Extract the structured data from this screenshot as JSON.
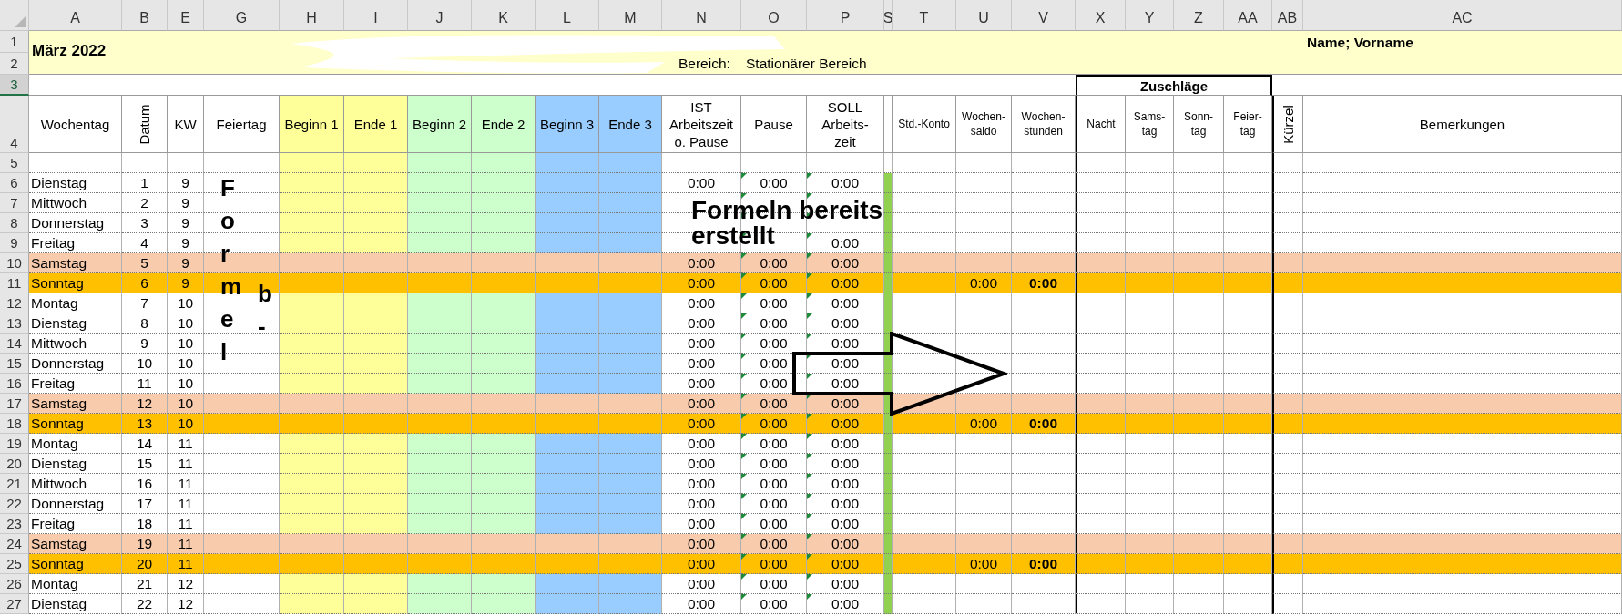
{
  "columns": [
    "A",
    "B",
    "E",
    "G",
    "H",
    "I",
    "J",
    "K",
    "L",
    "M",
    "N",
    "O",
    "P",
    "S",
    "T",
    "U",
    "V",
    "X",
    "Y",
    "Z",
    "AA",
    "AB",
    "AC"
  ],
  "title_band": {
    "row_numbers": [
      "1",
      "2"
    ],
    "month": "März 2022",
    "area_label": "Bereich:",
    "area_value": "Stationärer Bereich",
    "name": "Name; Vorname"
  },
  "row_3": {
    "number": "3",
    "selected": true,
    "group_heading": "Zuschläge"
  },
  "header_row": {
    "number": "4",
    "cells": [
      {
        "text": "Wochentag",
        "kind": "plain"
      },
      {
        "text": "Datum",
        "kind": "rotated"
      },
      {
        "text": "KW",
        "kind": "plain"
      },
      {
        "text": "Feiertag",
        "kind": "plain"
      },
      {
        "text": "Beginn 1",
        "kind": "plain",
        "color": "#ffff99"
      },
      {
        "text": "Ende 1",
        "kind": "plain",
        "color": "#ffff99"
      },
      {
        "text": "Beginn 2",
        "kind": "plain",
        "color": "#ccffcc"
      },
      {
        "text": "Ende 2",
        "kind": "plain",
        "color": "#ccffcc"
      },
      {
        "text": "Beginn 3",
        "kind": "plain",
        "color": "#99ccff"
      },
      {
        "text": "Ende 3",
        "kind": "plain",
        "color": "#99ccff"
      },
      {
        "text": "IST Arbeitszeit o. Pause",
        "kind": "plain"
      },
      {
        "text": "Pause",
        "kind": "plain"
      },
      {
        "text": "SOLL Arbeits-zeit",
        "kind": "narrow"
      },
      {
        "text": "",
        "kind": "spacer"
      },
      {
        "text": "Std.-Konto",
        "kind": "small_line"
      },
      {
        "text": "Wochen-saldo",
        "kind": "small"
      },
      {
        "text": "Wochen-stunden",
        "kind": "small"
      },
      {
        "text": "Nacht",
        "kind": "small"
      },
      {
        "text": "Sams-tag",
        "kind": "small"
      },
      {
        "text": "Sonn-tag",
        "kind": "small"
      },
      {
        "text": "Feier-tag",
        "kind": "small"
      },
      {
        "text": "Kürzel",
        "kind": "rotated"
      },
      {
        "text": "Bemerkungen",
        "kind": "plain"
      }
    ]
  },
  "row_5": {
    "number": "5"
  },
  "rows": [
    {
      "number": "6",
      "day": "Dienstag",
      "date": "1",
      "week": "9",
      "kind": "weekday",
      "actual": "0:00",
      "pause": "0:00",
      "target": "0:00",
      "flagged": true
    },
    {
      "number": "7",
      "day": "Mittwoch",
      "date": "2",
      "week": "9",
      "kind": "weekday",
      "flagged": true
    },
    {
      "number": "8",
      "day": "Donnerstag",
      "date": "3",
      "week": "9",
      "kind": "weekday",
      "flagged": true
    },
    {
      "number": "9",
      "day": "Freitag",
      "date": "4",
      "week": "9",
      "kind": "weekday",
      "target": "0:00",
      "flagged": true
    },
    {
      "number": "10",
      "day": "Samstag",
      "date": "5",
      "week": "9",
      "kind": "saturday",
      "actual": "0:00",
      "pause": "0:00",
      "target": "0:00",
      "flagged": true
    },
    {
      "number": "11",
      "day": "Sonntag",
      "date": "6",
      "week": "9",
      "kind": "sunday",
      "actual": "0:00",
      "pause": "0:00",
      "target": "0:00",
      "flagged": true,
      "weekly_balance": "0:00",
      "weekly_hours": "0:00"
    },
    {
      "number": "12",
      "day": "Montag",
      "date": "7",
      "week": "10",
      "kind": "weekday",
      "actual": "0:00",
      "pause": "0:00",
      "target": "0:00",
      "flagged": true
    },
    {
      "number": "13",
      "day": "Dienstag",
      "date": "8",
      "week": "10",
      "kind": "weekday",
      "actual": "0:00",
      "pause": "0:00",
      "target": "0:00",
      "flagged": true
    },
    {
      "number": "14",
      "day": "Mittwoch",
      "date": "9",
      "week": "10",
      "kind": "weekday",
      "actual": "0:00",
      "pause": "0:00",
      "target": "0:00",
      "flagged": true
    },
    {
      "number": "15",
      "day": "Donnerstag",
      "date": "10",
      "week": "10",
      "kind": "weekday",
      "actual": "0:00",
      "pause": "0:00",
      "target": "0:00",
      "flagged": true
    },
    {
      "number": "16",
      "day": "Freitag",
      "date": "11",
      "week": "10",
      "kind": "weekday",
      "actual": "0:00",
      "pause": "0:00",
      "target": "0:00",
      "flagged": true
    },
    {
      "number": "17",
      "day": "Samstag",
      "date": "12",
      "week": "10",
      "kind": "saturday",
      "actual": "0:00",
      "pause": "0:00",
      "target": "0:00",
      "flagged": true
    },
    {
      "number": "18",
      "day": "Sonntag",
      "date": "13",
      "week": "10",
      "kind": "sunday",
      "actual": "0:00",
      "pause": "0:00",
      "target": "0:00",
      "flagged": true,
      "weekly_balance": "0:00",
      "weekly_hours": "0:00"
    },
    {
      "number": "19",
      "day": "Montag",
      "date": "14",
      "week": "11",
      "kind": "weekday",
      "actual": "0:00",
      "pause": "0:00",
      "target": "0:00",
      "flagged": true
    },
    {
      "number": "20",
      "day": "Dienstag",
      "date": "15",
      "week": "11",
      "kind": "weekday",
      "actual": "0:00",
      "pause": "0:00",
      "target": "0:00",
      "flagged": true
    },
    {
      "number": "21",
      "day": "Mittwoch",
      "date": "16",
      "week": "11",
      "kind": "weekday",
      "actual": "0:00",
      "pause": "0:00",
      "target": "0:00",
      "flagged": true
    },
    {
      "number": "22",
      "day": "Donnerstag",
      "date": "17",
      "week": "11",
      "kind": "weekday",
      "actual": "0:00",
      "pause": "0:00",
      "target": "0:00",
      "flagged": true
    },
    {
      "number": "23",
      "day": "Freitag",
      "date": "18",
      "week": "11",
      "kind": "weekday",
      "actual": "0:00",
      "pause": "0:00",
      "target": "0:00",
      "flagged": true
    },
    {
      "number": "24",
      "day": "Samstag",
      "date": "19",
      "week": "11",
      "kind": "saturday",
      "actual": "0:00",
      "pause": "0:00",
      "target": "0:00",
      "flagged": true
    },
    {
      "number": "25",
      "day": "Sonntag",
      "date": "20",
      "week": "11",
      "kind": "sunday",
      "actual": "0:00",
      "pause": "0:00",
      "target": "0:00",
      "flagged": true,
      "weekly_balance": "0:00",
      "weekly_hours": "0:00"
    },
    {
      "number": "26",
      "day": "Montag",
      "date": "21",
      "week": "12",
      "kind": "weekday",
      "actual": "0:00",
      "pause": "0:00",
      "target": "0:00",
      "flagged": true
    },
    {
      "number": "27",
      "day": "Dienstag",
      "date": "22",
      "week": "12",
      "kind": "weekday",
      "actual": "0:00",
      "pause": "0:00",
      "target": "0:00",
      "flagged": true
    }
  ],
  "overlays": {
    "vertical_note": "Formel",
    "vertical_note_cut": "b-",
    "note_lines": [
      "Formeln bereits",
      "erstellt"
    ]
  }
}
